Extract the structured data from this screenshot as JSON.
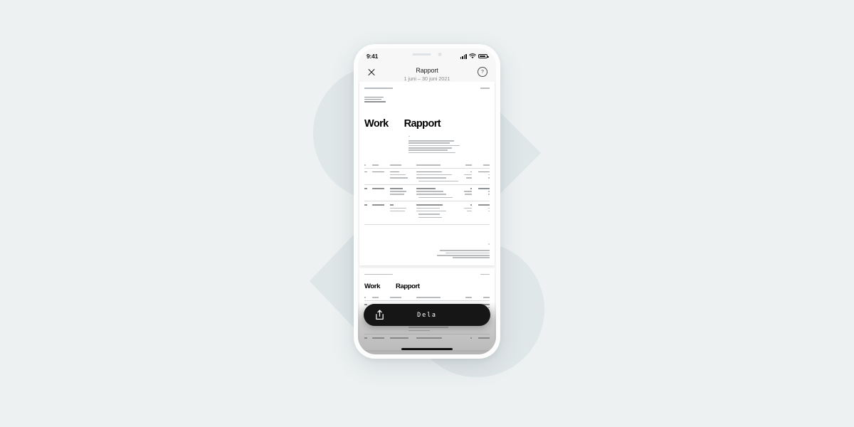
{
  "background": {
    "color": "#edf1f2",
    "shape_color": "#dde5e8"
  },
  "phone": {
    "status_bar": {
      "time": "9:41",
      "icons": [
        "cellular-signal-icon",
        "wifi-icon",
        "battery-icon"
      ]
    },
    "nav": {
      "close_icon": "close-icon",
      "title": "Rapport",
      "subtitle": "1 juni – 30 juni 2021",
      "help_icon": "help-icon",
      "help_glyph": "?"
    },
    "share_bar": {
      "icon": "share-icon",
      "label": "Dela"
    }
  },
  "document": {
    "heading_left": "Work",
    "heading_right": "Rapport",
    "page1_label": "",
    "page2_label": ""
  }
}
